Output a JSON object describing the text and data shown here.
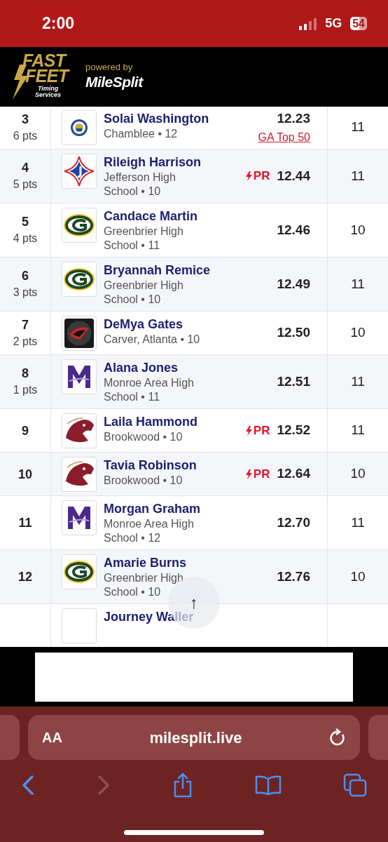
{
  "status_bar": {
    "time": "2:00",
    "network": "5G",
    "battery": "54"
  },
  "header": {
    "brand_top": "FAST",
    "brand_middle": "FEET",
    "brand_sub_1": "Timing",
    "brand_sub_2": "Services",
    "powered_by": "powered by",
    "partner": "MileSplit"
  },
  "results": [
    {
      "place": "3",
      "points": "6 pts",
      "logo": {
        "kind": "seal"
      },
      "name": "Solai Washington",
      "school": "Chamblee • 12",
      "pr": false,
      "time": "12.23",
      "badge": "GA Top 50",
      "column_5": "11"
    },
    {
      "place": "4",
      "points": "5 pts",
      "logo": {
        "kind": "diamond"
      },
      "name": "Rileigh Harrison",
      "school": "Jefferson High School • 10",
      "pr": true,
      "pr_label": "PR",
      "time": "12.44",
      "column_5": "11"
    },
    {
      "place": "5",
      "points": "4 pts",
      "logo": {
        "kind": "oval"
      },
      "name": "Candace Martin",
      "school": "Greenbrier High School • 11",
      "pr": false,
      "time": "12.46",
      "column_5": "10"
    },
    {
      "place": "6",
      "points": "3 pts",
      "logo": {
        "kind": "oval"
      },
      "name": "Bryannah Remice",
      "school": "Greenbrier High School • 10",
      "pr": false,
      "time": "12.49",
      "column_5": "11"
    },
    {
      "place": "7",
      "points": "2 pts",
      "logo": {
        "kind": "panther"
      },
      "name": "DeMya Gates",
      "school": "Carver, Atlanta • 10",
      "pr": false,
      "time": "12.50",
      "column_5": "10"
    },
    {
      "place": "8",
      "points": "1 pts",
      "logo": {
        "kind": "purple"
      },
      "name": "Alana Jones",
      "school": "Monroe Area High School • 11",
      "pr": false,
      "time": "12.51",
      "column_5": "11"
    },
    {
      "place": "9",
      "logo": {
        "kind": "horse"
      },
      "name": "Laila Hammond",
      "school": "Brookwood • 10",
      "pr": true,
      "pr_label": "PR",
      "time": "12.52",
      "column_5": "11"
    },
    {
      "place": "10",
      "logo": {
        "kind": "horse"
      },
      "name": "Tavia Robinson",
      "school": "Brookwood • 10",
      "pr": true,
      "pr_label": "PR",
      "time": "12.64",
      "column_5": "10"
    },
    {
      "place": "11",
      "logo": {
        "kind": "purple"
      },
      "name": "Morgan Graham",
      "school": "Monroe Area High School • 12",
      "pr": false,
      "time": "12.70",
      "column_5": "11"
    },
    {
      "place": "12",
      "logo": {
        "kind": "oval"
      },
      "name": "Amarie Burns",
      "school": "Greenbrier High School • 10",
      "pr": false,
      "time": "12.76",
      "column_5": "10"
    },
    {
      "name": "Journey Waller"
    }
  ],
  "scroll_top_button": {
    "label": "↑"
  },
  "browser": {
    "text_size": "AA",
    "url": "milesplit.live",
    "back_disabled": false,
    "forward_disabled": true
  }
}
